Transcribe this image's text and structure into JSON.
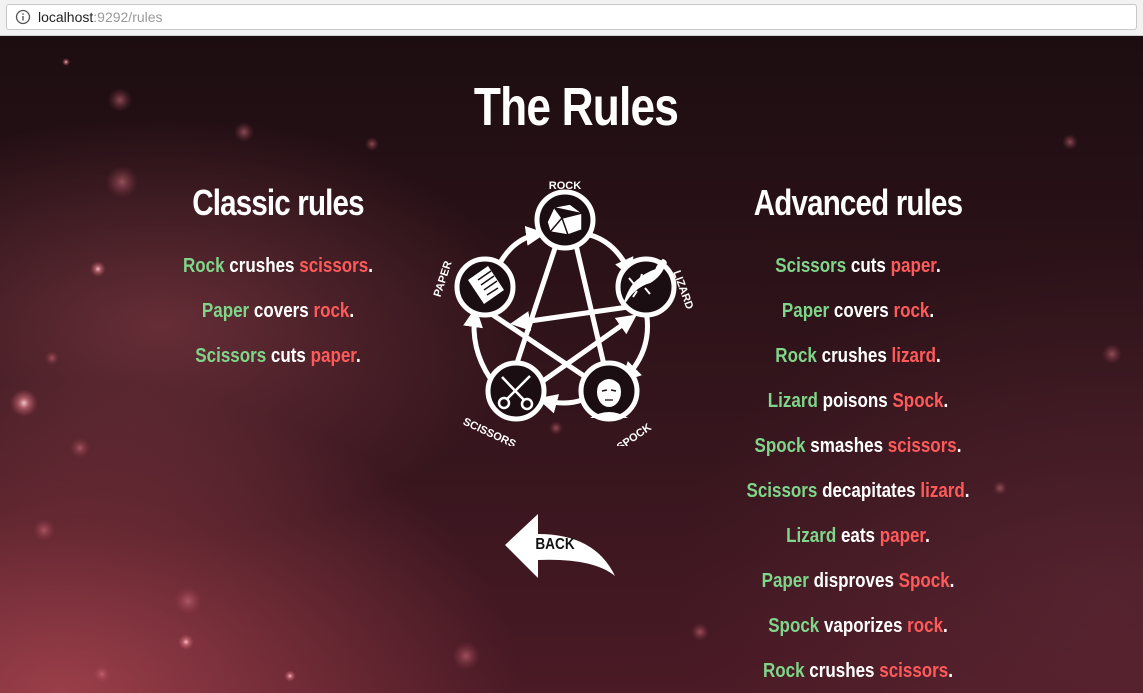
{
  "browser": {
    "url_host": "localhost",
    "url_rest": ":9292/rules",
    "info_icon": "info-circle-icon"
  },
  "page": {
    "title": "The Rules",
    "back_label": "BACK",
    "colors": {
      "winner": "#7fd68a",
      "verb": "#ffffff",
      "loser": "#ff5a5a",
      "background": "#2b1218"
    }
  },
  "classic": {
    "title": "Classic rules",
    "rules": [
      {
        "winner": "Rock",
        "verb": "crushes",
        "loser": "scissors"
      },
      {
        "winner": "Paper",
        "verb": "covers",
        "loser": "rock"
      },
      {
        "winner": "Scissors",
        "verb": "cuts",
        "loser": "paper"
      }
    ]
  },
  "diagram": {
    "labels": {
      "rock": "ROCK",
      "lizard": "LIZARD",
      "spock": "SPOCK",
      "scissors": "SCISSORS",
      "paper": "PAPER"
    }
  },
  "advanced": {
    "title": "Advanced rules",
    "rules": [
      {
        "winner": "Scissors",
        "verb": "cuts",
        "loser": "paper"
      },
      {
        "winner": "Paper",
        "verb": "covers",
        "loser": "rock"
      },
      {
        "winner": "Rock",
        "verb": "crushes",
        "loser": "lizard"
      },
      {
        "winner": "Lizard",
        "verb": "poisons",
        "loser": "Spock"
      },
      {
        "winner": "Spock",
        "verb": "smashes",
        "loser": "scissors"
      },
      {
        "winner": "Scissors",
        "verb": "decapitates",
        "loser": "lizard"
      },
      {
        "winner": "Lizard",
        "verb": "eats",
        "loser": "paper"
      },
      {
        "winner": "Paper",
        "verb": "disproves",
        "loser": "Spock"
      },
      {
        "winner": "Spock",
        "verb": "vaporizes",
        "loser": "rock"
      },
      {
        "winner": "Rock",
        "verb": "crushes",
        "loser": "scissors"
      }
    ]
  }
}
